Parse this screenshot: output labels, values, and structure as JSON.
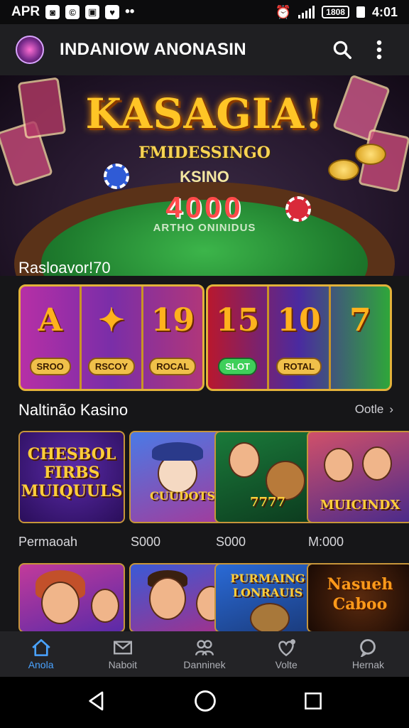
{
  "status_bar": {
    "carrier": "APR",
    "battery_text": "1808",
    "time": "4:01"
  },
  "app_bar": {
    "title": "INDANIOW ANONASIN",
    "search_icon": "search-icon",
    "menu_icon": "more-vert-icon"
  },
  "hero": {
    "title": "KASAGIA!",
    "subtitle": "FMIDESSINGO",
    "line2": "KSINO",
    "numbers": "4000",
    "caption": "ARTHO ONINIDUS"
  },
  "sections": {
    "featured_label": "Rasloavor!70",
    "games_label": "Naltinão Kasino",
    "see_all_label": "Ootle"
  },
  "slots": [
    {
      "reels": [
        {
          "symbol": "A",
          "button": "SROO"
        },
        {
          "symbol": "✦",
          "button": "RSCOY"
        },
        {
          "symbol": "19",
          "button": "ROCAL"
        }
      ]
    },
    {
      "reels": [
        {
          "symbol": "15",
          "button": "SLOT"
        },
        {
          "symbol": "10",
          "button": "ROTAL"
        },
        {
          "symbol": "7",
          "button": ""
        }
      ]
    }
  ],
  "games_row1": [
    {
      "title": "CHESBOL FIRBS MUIQUULS",
      "caption": "Permaoah"
    },
    {
      "title": "CUUDOTS",
      "caption": "S000"
    },
    {
      "title": "7777",
      "caption": "S000"
    },
    {
      "title": "MUICINDX",
      "caption": "M:000"
    }
  ],
  "games_row2": [
    {
      "title": ""
    },
    {
      "title": ""
    },
    {
      "title": "PURMAING LONRAUIS"
    },
    {
      "title": "Nasueh Caboo"
    }
  ],
  "bottom_nav": [
    {
      "label": "Anola",
      "icon": "home-icon",
      "active": true
    },
    {
      "label": "Naboit",
      "icon": "mail-icon",
      "active": false
    },
    {
      "label": "Danninek",
      "icon": "people-icon",
      "active": false
    },
    {
      "label": "Volte",
      "icon": "heart-icon",
      "active": false
    },
    {
      "label": "Hernak",
      "icon": "chat-icon",
      "active": false
    }
  ],
  "colors": {
    "accent": "#4aa3ff",
    "gold": "#ffc526",
    "background": "#161618"
  }
}
